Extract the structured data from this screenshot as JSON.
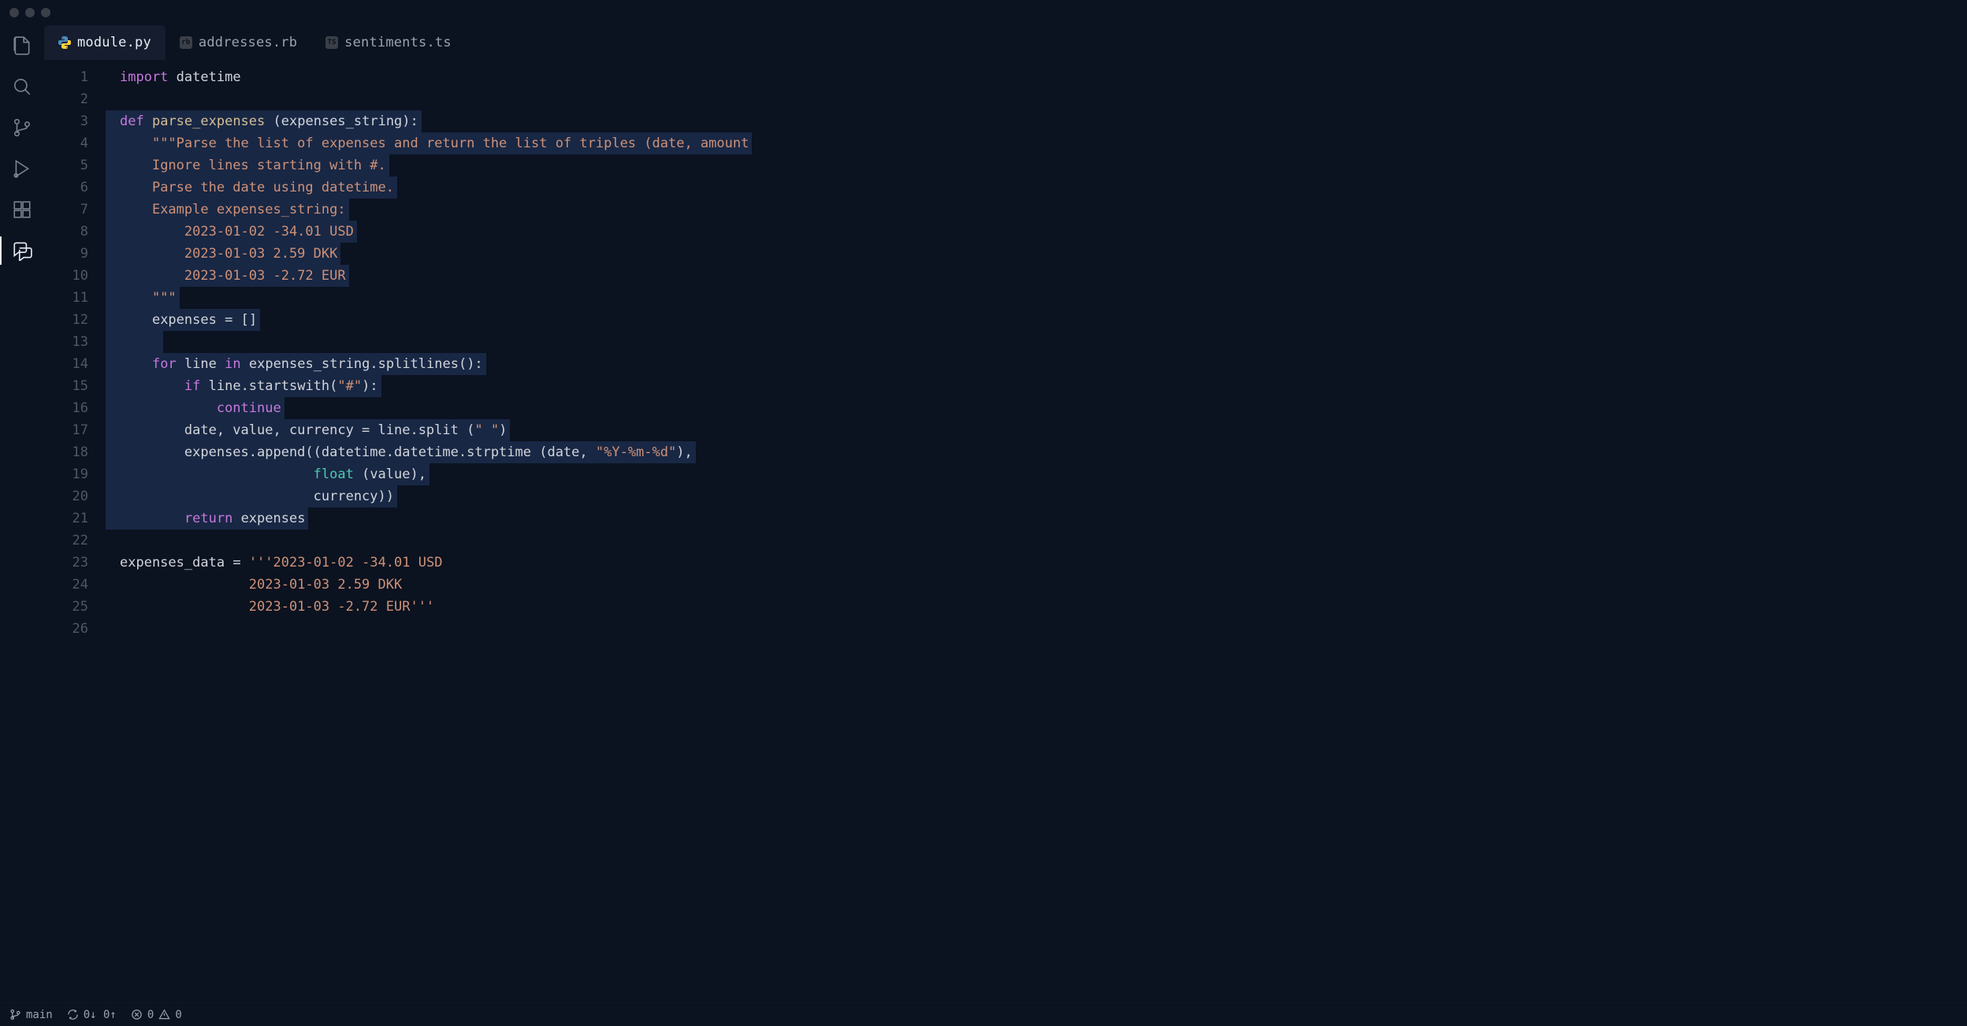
{
  "tabs": [
    {
      "label": "module.py",
      "icon": "python-icon",
      "active": true
    },
    {
      "label": "addresses.rb",
      "icon": "ruby-icon",
      "active": false
    },
    {
      "label": "sentiments.ts",
      "icon": "typescript-icon",
      "active": false
    }
  ],
  "code": {
    "lines": [
      {
        "n": 1,
        "sel": false,
        "tokens": [
          [
            "kw",
            "import"
          ],
          [
            "sp",
            " "
          ],
          [
            "ident",
            "datetime"
          ]
        ]
      },
      {
        "n": 2,
        "sel": false,
        "tokens": []
      },
      {
        "n": 3,
        "sel": true,
        "tokens": [
          [
            "def",
            "def"
          ],
          [
            "sp",
            " "
          ],
          [
            "fn",
            "parse_expenses"
          ],
          [
            "sp",
            " "
          ],
          [
            "op",
            "("
          ],
          [
            "ident",
            "expenses_string"
          ],
          [
            "op",
            "):"
          ]
        ]
      },
      {
        "n": 4,
        "sel": true,
        "indent": 1,
        "tokens": [
          [
            "str",
            "\"\"\"Parse the list of expenses and return the list of triples (date, amount"
          ]
        ]
      },
      {
        "n": 5,
        "sel": true,
        "indent": 1,
        "tokens": [
          [
            "str",
            "Ignore lines starting with #."
          ]
        ]
      },
      {
        "n": 6,
        "sel": true,
        "indent": 1,
        "tokens": [
          [
            "str",
            "Parse the date using datetime."
          ]
        ]
      },
      {
        "n": 7,
        "sel": true,
        "indent": 1,
        "tokens": [
          [
            "str",
            "Example expenses_string:"
          ]
        ]
      },
      {
        "n": 8,
        "sel": true,
        "indent": 2,
        "tokens": [
          [
            "str",
            "2023-01-02 -34.01 USD"
          ]
        ]
      },
      {
        "n": 9,
        "sel": true,
        "indent": 2,
        "tokens": [
          [
            "str",
            "2023-01-03 2.59 DKK"
          ]
        ]
      },
      {
        "n": 10,
        "sel": true,
        "indent": 2,
        "tokens": [
          [
            "str",
            "2023-01-03 -2.72 EUR"
          ]
        ]
      },
      {
        "n": 11,
        "sel": true,
        "indent": 1,
        "tokens": [
          [
            "str",
            "\"\"\""
          ]
        ]
      },
      {
        "n": 12,
        "sel": true,
        "indent": 1,
        "tokens": [
          [
            "ident",
            "expenses"
          ],
          [
            "sp",
            " "
          ],
          [
            "op",
            "="
          ],
          [
            "sp",
            " "
          ],
          [
            "op",
            "[]"
          ]
        ]
      },
      {
        "n": 13,
        "sel": true,
        "indent": 1,
        "tokens": []
      },
      {
        "n": 14,
        "sel": true,
        "indent": 1,
        "tokens": [
          [
            "kw",
            "for"
          ],
          [
            "sp",
            " "
          ],
          [
            "ident",
            "line"
          ],
          [
            "sp",
            " "
          ],
          [
            "kw",
            "in"
          ],
          [
            "sp",
            " "
          ],
          [
            "ident",
            "expenses_string.splitlines():"
          ]
        ]
      },
      {
        "n": 15,
        "sel": true,
        "indent": 2,
        "tokens": [
          [
            "kw",
            "if"
          ],
          [
            "sp",
            " "
          ],
          [
            "ident",
            "line.startswith("
          ],
          [
            "str",
            "\"#\""
          ],
          [
            "ident",
            "):"
          ]
        ]
      },
      {
        "n": 16,
        "sel": true,
        "indent": 3,
        "tokens": [
          [
            "kw",
            "continue"
          ]
        ]
      },
      {
        "n": 17,
        "sel": true,
        "indent": 2,
        "tokens": [
          [
            "ident",
            "date, value, currency = line.split ("
          ],
          [
            "str",
            "\" \""
          ],
          [
            "ident",
            ")"
          ]
        ]
      },
      {
        "n": 18,
        "sel": true,
        "indent": 2,
        "tokens": [
          [
            "ident",
            "expenses.append((datetime.datetime.strptime (date, "
          ],
          [
            "str",
            "\"%Y-%m-%d\""
          ],
          [
            "ident",
            "),"
          ]
        ]
      },
      {
        "n": 19,
        "sel": true,
        "indent": 6,
        "tokens": [
          [
            "builtin",
            "float"
          ],
          [
            "sp",
            " "
          ],
          [
            "ident",
            "(value),"
          ]
        ]
      },
      {
        "n": 20,
        "sel": true,
        "indent": 6,
        "tokens": [
          [
            "ident",
            "currency))"
          ]
        ]
      },
      {
        "n": 21,
        "sel": true,
        "indent": 2,
        "tokens": [
          [
            "kw",
            "return"
          ],
          [
            "sp",
            " "
          ],
          [
            "ident",
            "expenses"
          ]
        ]
      },
      {
        "n": 22,
        "sel": false,
        "tokens": []
      },
      {
        "n": 23,
        "sel": false,
        "tokens": [
          [
            "ident",
            "expenses_data"
          ],
          [
            "sp",
            " "
          ],
          [
            "op",
            "="
          ],
          [
            "sp",
            " "
          ],
          [
            "str",
            "'''2023-01-02 -34.01 USD"
          ]
        ]
      },
      {
        "n": 24,
        "sel": false,
        "indent": 4,
        "tokens": [
          [
            "str",
            "2023-01-03 2.59 DKK"
          ]
        ]
      },
      {
        "n": 25,
        "sel": false,
        "indent": 4,
        "tokens": [
          [
            "str",
            "2023-01-03 -2.72 EUR'''"
          ]
        ]
      },
      {
        "n": 26,
        "sel": false,
        "tokens": []
      }
    ]
  },
  "statusbar": {
    "branch": "main",
    "sync": "0↓ 0↑",
    "errors": "0",
    "warnings": "0"
  }
}
